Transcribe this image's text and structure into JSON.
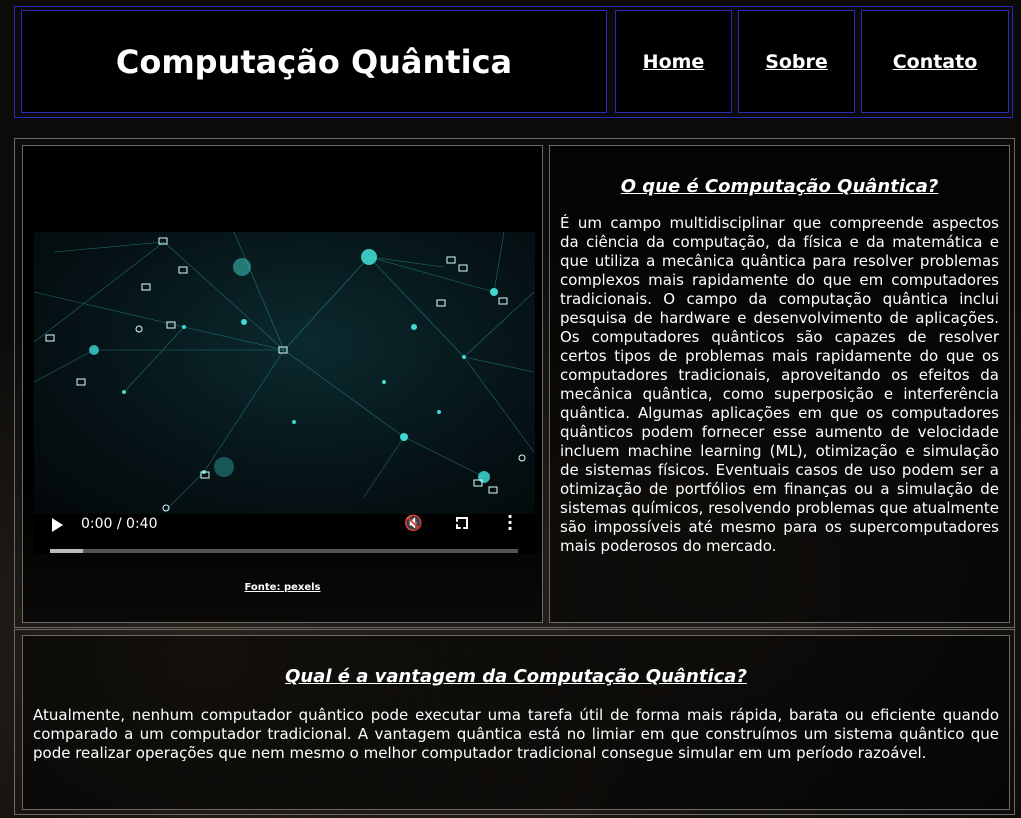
{
  "header": {
    "title": "Computação Quântica",
    "nav": [
      {
        "label": "Home"
      },
      {
        "label": "Sobre"
      },
      {
        "label": "Contato"
      }
    ]
  },
  "video": {
    "time": "0:00 / 0:40",
    "progress": 0.07,
    "icons": {
      "play": "play-icon",
      "volume": "volume-icon",
      "fullscreen": "fullscreen-icon",
      "more": "more-options-icon"
    },
    "source_label": "Fonte: pexels"
  },
  "section1": {
    "heading": "O que é Computação Quântica?",
    "body": "É um campo multidisciplinar que compreende aspectos da ciência da computação, da física e da matemática e que utiliza a mecânica quântica para resolver problemas complexos mais rapidamente do que em computadores tradicionais. O campo da computação quântica inclui pesquisa de hardware e desenvolvimento de aplicações. Os computadores quânticos são capazes de resolver certos tipos de problemas mais rapidamente do que os computadores tradicionais, aproveitando os efeitos da mecânica quântica, como superposição e interferência quântica. Algumas aplicações em que os computadores quânticos podem fornecer esse aumento de velocidade incluem machine learning (ML), otimização e simulação de sistemas físicos. Eventuais casos de uso podem ser a otimização de portfólios em finanças ou a simulação de sistemas químicos, resolvendo problemas que atualmente são impossíveis até mesmo para os supercomputadores mais poderosos do mercado."
  },
  "section2": {
    "heading": "Qual é a vantagem da Computação Quântica?",
    "body": "Atualmente, nenhum computador quântico pode executar uma tarefa útil de forma mais rápida, barata ou eficiente quando comparado a um computador tradicional. A vantagem quântica está no limiar em que construímos um sistema quântico que pode realizar operações que nem mesmo o melhor computador tradicional consegue simular em um período razoável."
  }
}
